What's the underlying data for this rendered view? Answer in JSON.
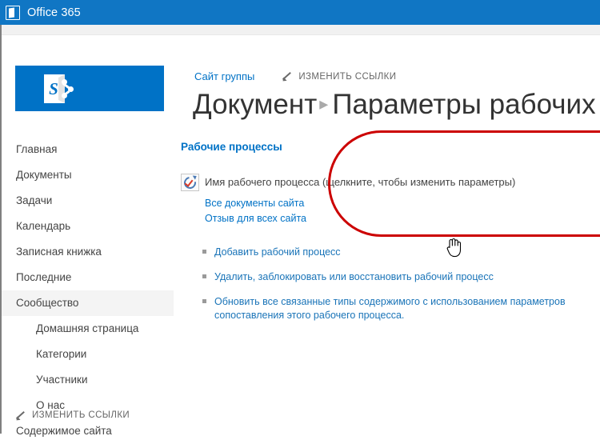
{
  "suite": {
    "logo_icon": "office-logo-icon",
    "brand": "Office 365"
  },
  "sidebar": {
    "logo": {
      "icon": "sharepoint-logo-icon",
      "letter": "S"
    },
    "items": [
      {
        "label": "Главная",
        "sub": false,
        "selected": false
      },
      {
        "label": "Документы",
        "sub": false,
        "selected": false
      },
      {
        "label": "Задачи",
        "sub": false,
        "selected": false
      },
      {
        "label": "Календарь",
        "sub": false,
        "selected": false
      },
      {
        "label": "Записная книжка",
        "sub": false,
        "selected": false
      },
      {
        "label": "Последние",
        "sub": false,
        "selected": false
      },
      {
        "label": "Сообщество",
        "sub": false,
        "selected": true
      },
      {
        "label": "Домашняя страница",
        "sub": true,
        "selected": false
      },
      {
        "label": "Категории",
        "sub": true,
        "selected": false
      },
      {
        "label": "Участники",
        "sub": true,
        "selected": false
      },
      {
        "label": "О нас",
        "sub": true,
        "selected": false
      },
      {
        "label": "Содержимое сайта",
        "sub": false,
        "selected": false
      }
    ],
    "edit_links": {
      "icon": "pencil-icon",
      "label": "ИЗМЕНИТЬ ССЫЛКИ"
    }
  },
  "breadcrumb": {
    "site_link": "Сайт группы",
    "edit_links": {
      "icon": "pencil-icon",
      "label": "ИЗМЕНИТЬ ССЫЛКИ"
    }
  },
  "title": {
    "parent": "Документ",
    "separator": "▸",
    "current": "Параметры рабочих"
  },
  "main": {
    "section_heading": "Рабочие процессы",
    "workflow": {
      "icon": "workflow-check-icon",
      "label": "Имя рабочего процесса (щелкните, чтобы изменить параметры)",
      "links": [
        "Все документы сайта",
        "Отзыв для всех сайта"
      ]
    },
    "actions": [
      "Добавить рабочий процесс",
      "Удалить, заблокировать или восстановить рабочий процесс",
      "Обновить все связанные типы содержимого с использованием параметров сопоставления этого рабочего процесса."
    ]
  },
  "annotation": {
    "shape": "ellipse",
    "color": "#cc0000"
  },
  "cursor": {
    "type": "hand-pointer-cursor"
  },
  "colors": {
    "suite_bar": "#1076c4",
    "brand_blue": "#0072c6",
    "link_blue": "#1a74b8",
    "selected_row": "#f4f4f4",
    "annotation_red": "#cc0000"
  }
}
